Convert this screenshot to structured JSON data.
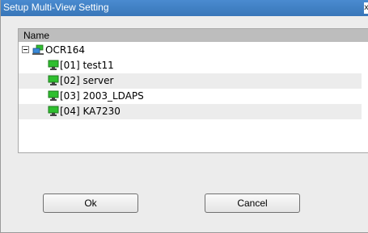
{
  "window": {
    "title": "Setup Multi-View Setting",
    "close_symbol": "x"
  },
  "tree": {
    "column_header": "Name",
    "root": {
      "label": "OCR164",
      "expander": "minus",
      "icon": "network-group-icon"
    },
    "items": [
      {
        "label": "[01] test11",
        "icon": "monitor-icon"
      },
      {
        "label": "[02] server",
        "icon": "monitor-icon"
      },
      {
        "label": "[03] 2003_LDAPS",
        "icon": "monitor-icon"
      },
      {
        "label": "[04] KA7230",
        "icon": "monitor-icon"
      }
    ]
  },
  "buttons": {
    "ok_label": "Ok",
    "cancel_label": "Cancel"
  },
  "colors": {
    "titlebar": "#3876b8",
    "monitor": "#2fbf2f",
    "header": "#bdbdbd"
  }
}
